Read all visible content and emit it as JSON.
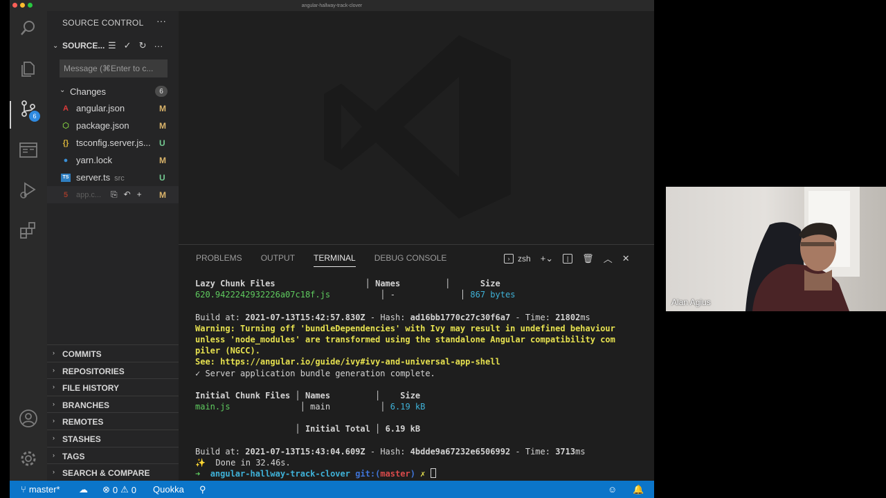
{
  "window": {
    "title": "angular-hallway-track-clover"
  },
  "sidebar": {
    "header": "SOURCE CONTROL",
    "more_glyph": "···",
    "provider_label": "SOURCE...",
    "message_placeholder": "Message (⌘Enter to c...",
    "changes_label": "Changes",
    "changes_count": "6",
    "files": [
      {
        "name": "angular.json",
        "dir": "",
        "status": "M",
        "icon": "angular-icon"
      },
      {
        "name": "package.json",
        "dir": "",
        "status": "M",
        "icon": "nodejs-icon"
      },
      {
        "name": "tsconfig.server.js...",
        "dir": "",
        "status": "U",
        "icon": "json-braces-icon"
      },
      {
        "name": "yarn.lock",
        "dir": "",
        "status": "M",
        "icon": "yarn-icon"
      },
      {
        "name": "server.ts",
        "dir": "src",
        "status": "U",
        "icon": "typescript-icon"
      },
      {
        "name": "app.c...",
        "dir": "",
        "status": "M",
        "icon": "html-icon"
      }
    ],
    "sections": [
      "COMMITS",
      "REPOSITORIES",
      "FILE HISTORY",
      "BRANCHES",
      "REMOTES",
      "STASHES",
      "TAGS",
      "SEARCH & COMPARE"
    ],
    "activity_badge": "6"
  },
  "panel": {
    "tabs": [
      "PROBLEMS",
      "OUTPUT",
      "TERMINAL",
      "DEBUG CONSOLE"
    ],
    "active_tab": "TERMINAL",
    "shell": "zsh"
  },
  "terminal": {
    "lazy_header": {
      "files": "Lazy Chunk Files",
      "names": "Names",
      "size": "Size"
    },
    "lazy_row": {
      "file": "620.9422242932226a07c18f.js",
      "name": "-",
      "size": "867 bytes"
    },
    "build1": {
      "prefix": "Build at: ",
      "date": "2021-07-13T15:42:57.830Z",
      "hash_label": " - Hash: ",
      "hash": "ad16bb1770c27c30f6a7",
      "time_label": " - Time: ",
      "time": "21802",
      "unit": "ms"
    },
    "warning1": "Warning: Turning off 'bundleDependencies' with Ivy may result in undefined behaviour",
    "warning2": "unless 'node_modules' are transformed using the standalone Angular compatibility com",
    "warning3": "piler (NGCC).",
    "see": "See: https://angular.io/guide/ivy#ivy-and-universal-app-shell",
    "complete": "✓ Server application bundle generation complete.",
    "initial_header": {
      "files": "Initial Chunk Files",
      "names": "Names",
      "size": "Size"
    },
    "initial_row": {
      "file": "main.js",
      "name": "main",
      "size": "6.19 kB"
    },
    "initial_total": {
      "label": "Initial Total",
      "size": "6.19 kB"
    },
    "build2": {
      "prefix": "Build at: ",
      "date": "2021-07-13T15:43:04.609Z",
      "hash_label": " - Hash: ",
      "hash": "4bdde9a67232e6506992",
      "time_label": " - Time: ",
      "time": "3713",
      "unit": "ms"
    },
    "done": "✨  Done in 32.46s.",
    "prompt": {
      "arrow": "➜",
      "dir": "angular-hallway-track-clover",
      "git": "git:(",
      "branch": "master",
      "git_close": ")",
      "dirty": "✗"
    }
  },
  "status": {
    "branch": "master*",
    "errors": "0",
    "warnings": "0",
    "quokka": "Quokka"
  },
  "video": {
    "name": "Alan Agius"
  }
}
